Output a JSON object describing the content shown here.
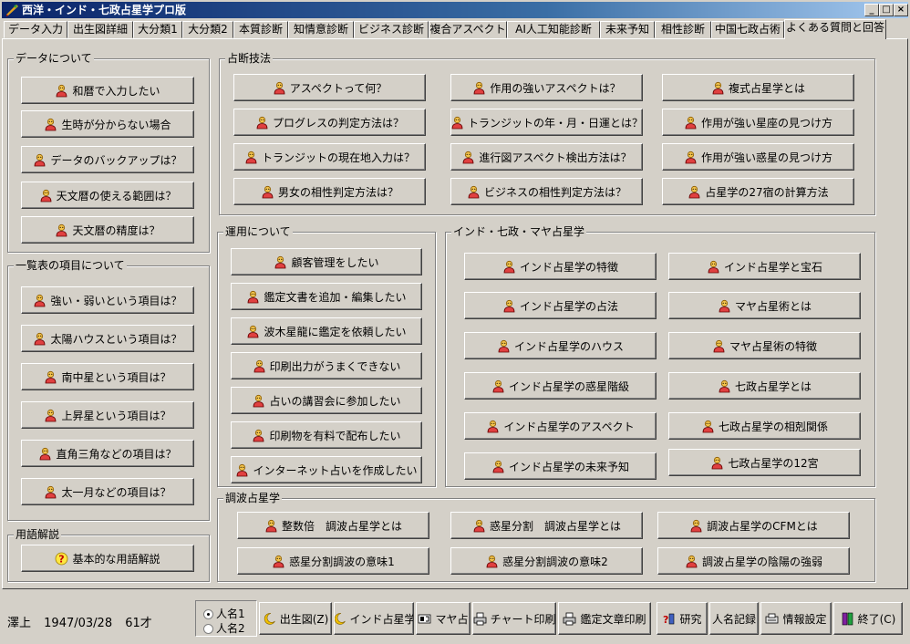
{
  "window": {
    "title": "西洋・インド・七政占星学プロ版",
    "controls": [
      "_",
      "□",
      "×"
    ]
  },
  "tabs": [
    "データ入力",
    "出生図詳細",
    "大分類1",
    "大分類2",
    "本質診断",
    "知情意診断",
    "ビジネス診断",
    "複合アスペクト",
    "AI人工知能診断",
    "未来予知",
    "相性診断",
    "中国七政占術",
    "よくある質問と回答"
  ],
  "active_tab": "よくある質問と回答",
  "groups": {
    "data": {
      "title": "データについて",
      "items": [
        "和暦で入力したい",
        "生時が分からない場合",
        "データのバックアップは？",
        "天文暦の使える範囲は？",
        "天文暦の精度は？"
      ]
    },
    "list": {
      "title": "一覧表の項目について",
      "items": [
        "強い・弱いという項目は？",
        "太陽ハウスという項目は？",
        "南中星という項目は？",
        "上昇星という項目は？",
        "直角三角などの項目は？",
        "太一月などの項目は？"
      ]
    },
    "terms": {
      "title": "用語解説",
      "items": [
        "基本的な用語解説"
      ]
    },
    "technique": {
      "title": "占断技法",
      "col1": [
        "アスペクトって何？",
        "プログレスの判定方法は？",
        "トランジットの現在地入力は？",
        "男女の相性判定方法は？"
      ],
      "col2": [
        "作用の強いアスペクトは？",
        "トランジットの年・月・日運とは？",
        "進行図アスペクト検出方法は？",
        "ビジネスの相性判定方法は？"
      ],
      "col3": [
        "複式占星学とは",
        "作用が強い星座の見つけ方",
        "作用が強い惑星の見つけ方",
        "占星学の27宿の計算方法"
      ]
    },
    "usage": {
      "title": "運用について",
      "items": [
        "顧客管理をしたい",
        "鑑定文書を追加・編集したい",
        "波木星龍に鑑定を依頼したい",
        "印刷出力がうまくできない",
        "占いの講習会に参加したい",
        "印刷物を有料で配布したい",
        "インターネット占いを作成したい"
      ]
    },
    "india": {
      "title": "インド・七政・マヤ占星学",
      "col1": [
        "インド占星学の特徴",
        "インド占星学の占法",
        "インド占星学のハウス",
        "インド占星学の惑星階級",
        "インド占星学のアスペクト",
        "インド占星学の未来予知"
      ],
      "col2": [
        "インド占星学と宝石",
        "マヤ占星術とは",
        "マヤ占星術の特徴",
        "七政占星学とは",
        "七政占星学の相剋関係",
        "七政占星学の12宮"
      ]
    },
    "harmonic": {
      "title": "調波占星学",
      "row1": [
        "整数倍　調波占星学とは",
        "惑星分割　調波占星学とは",
        "調波占星学のCFMとは"
      ],
      "row2": [
        "惑星分割調波の意味1",
        "惑星分割調波の意味2",
        "調波占星学の陰陽の強弱"
      ]
    }
  },
  "status": {
    "name": "澤上",
    "date": "1947/03/28",
    "age": "61才"
  },
  "radios": [
    {
      "label": "人名1",
      "checked": true
    },
    {
      "label": "人名2",
      "checked": false
    }
  ],
  "bottom_buttons": [
    "出生図(Z)",
    "インド占星学",
    "マヤ占",
    "チャート印刷",
    "鑑定文章印刷",
    "研究",
    "人名記録",
    "情報設定",
    "終了(C)"
  ]
}
